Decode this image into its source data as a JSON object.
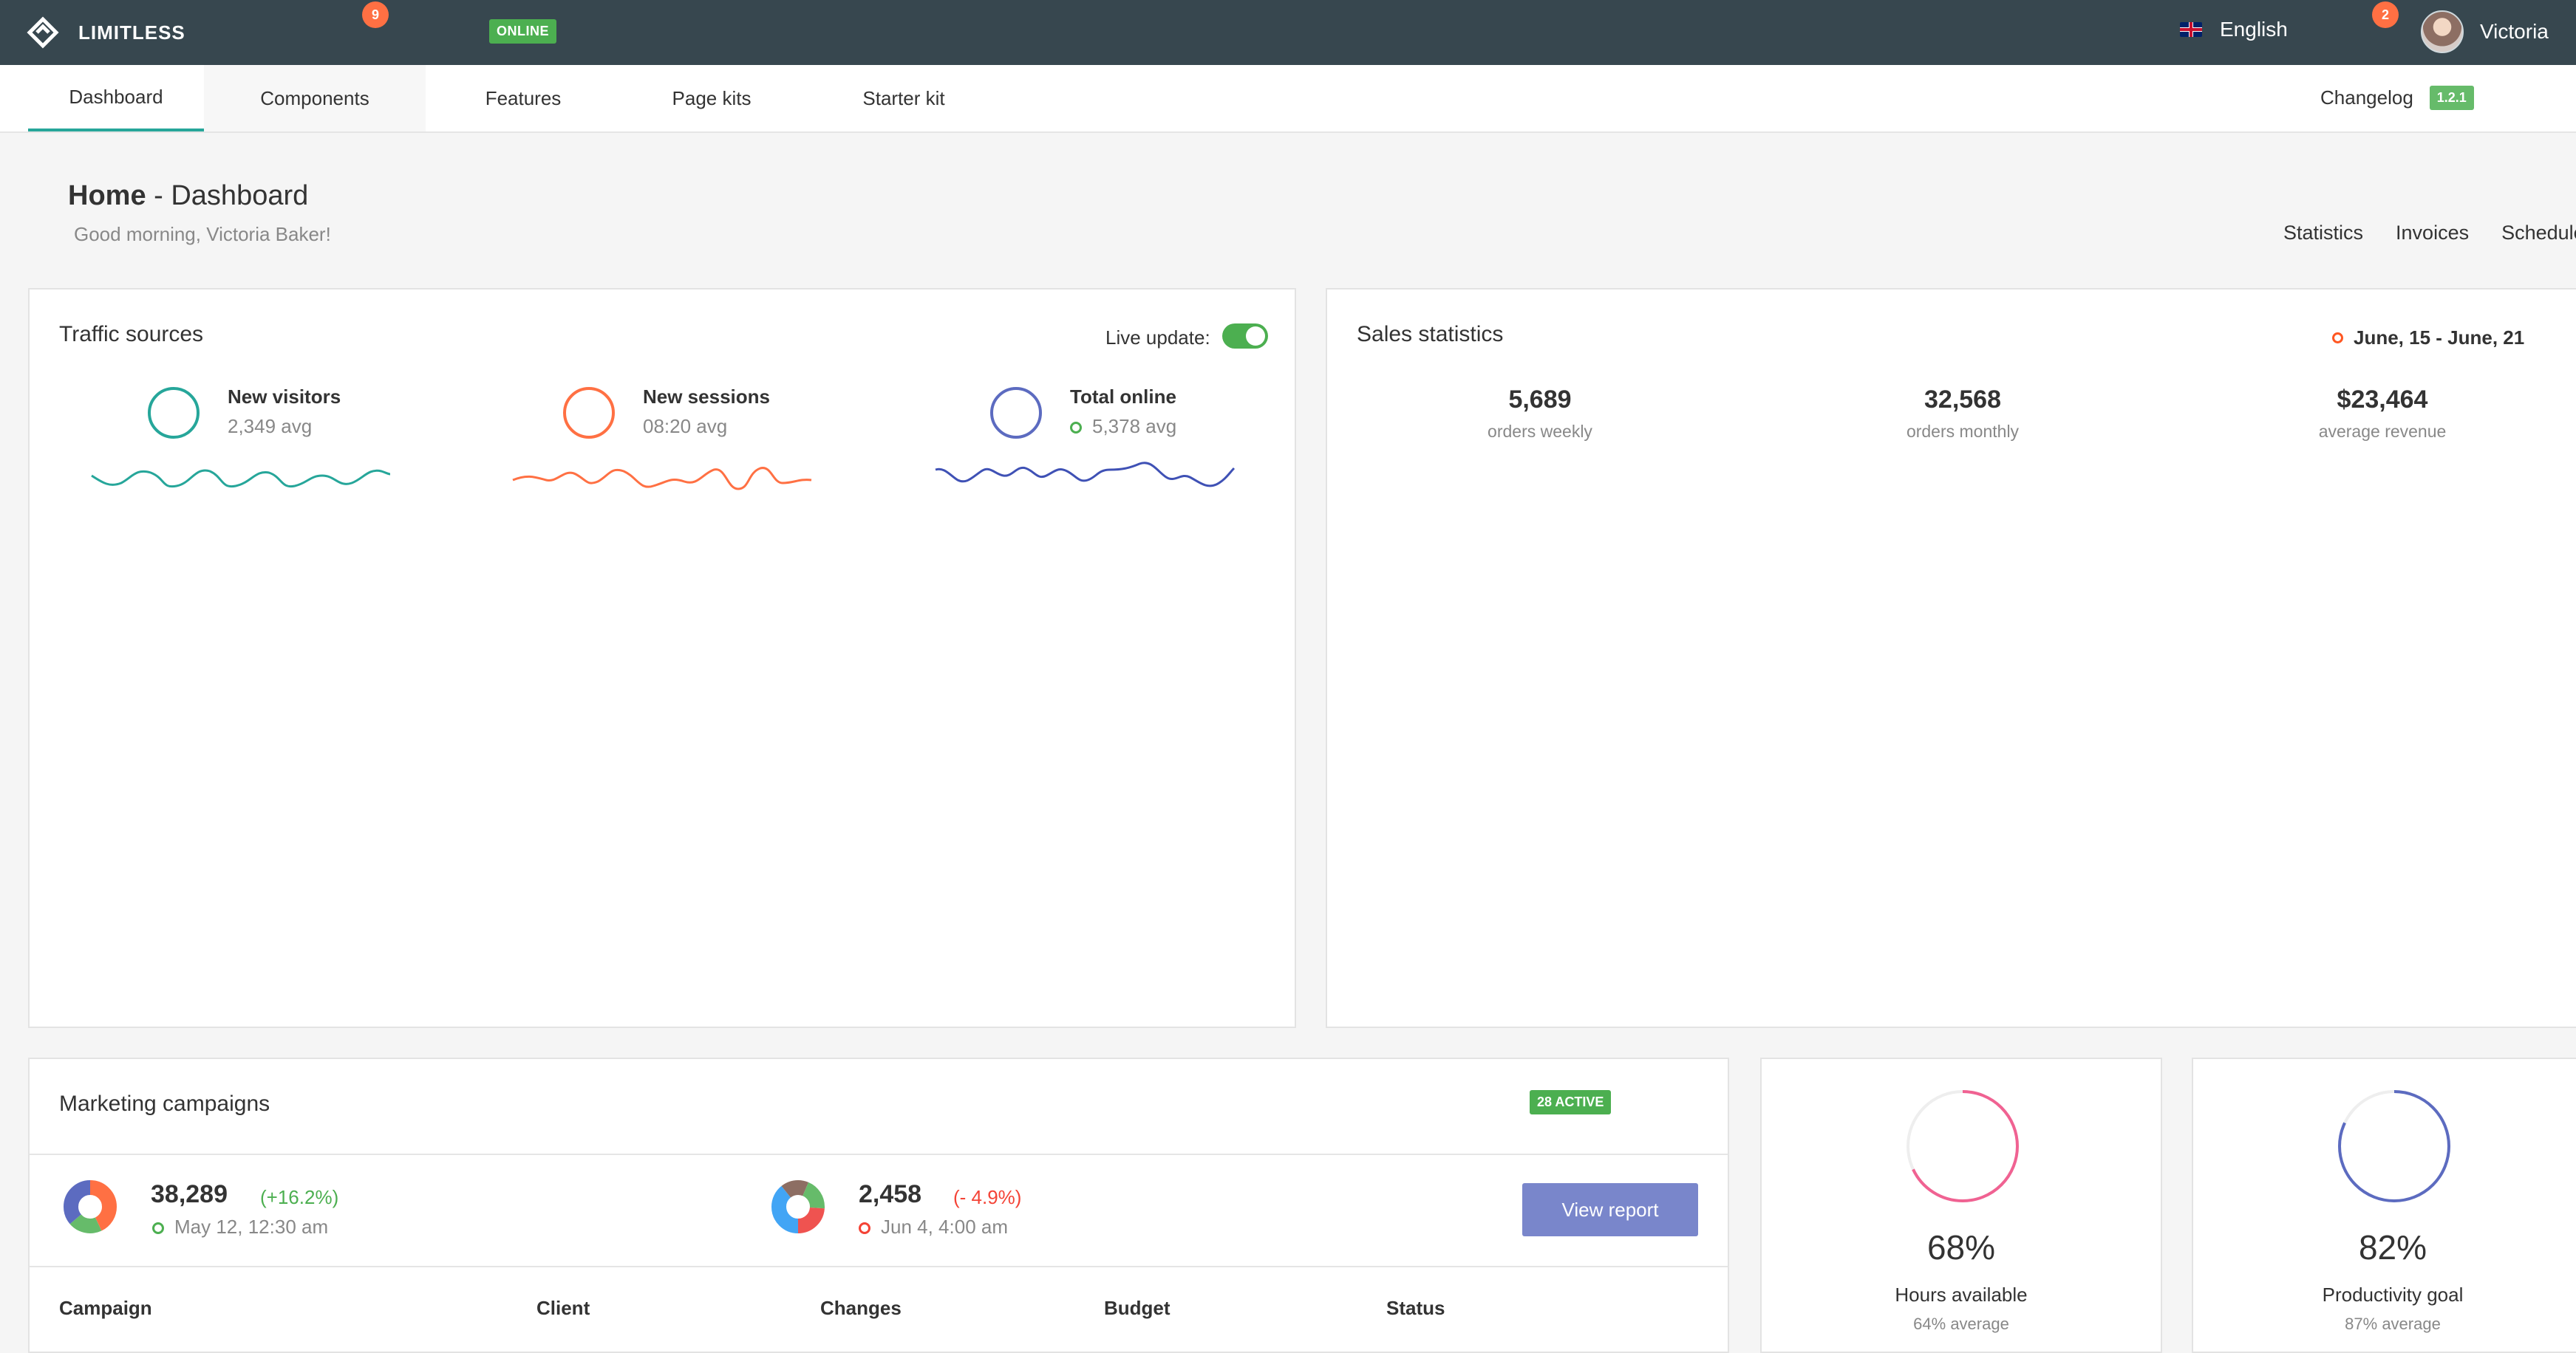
{
  "topbar": {
    "brand": "LIMITLESS",
    "badge_left": "9",
    "status_label": "ONLINE",
    "language": "English",
    "notif_count": "2",
    "user_name": "Victoria"
  },
  "subnav": {
    "tabs": [
      {
        "label": "Dashboard"
      },
      {
        "label": "Components"
      },
      {
        "label": "Features"
      },
      {
        "label": "Page kits"
      },
      {
        "label": "Starter kit"
      }
    ],
    "changelog_label": "Changelog",
    "version": "1.2.1"
  },
  "header": {
    "title_main": "Home",
    "title_sep": " - ",
    "title_sub": "Dashboard",
    "greeting": "Good morning, Victoria Baker!",
    "links": [
      "Statistics",
      "Invoices",
      "Schedule"
    ]
  },
  "traffic": {
    "title": "Traffic sources",
    "live_label": "Live update:",
    "live_enabled": true,
    "stats": [
      {
        "name": "New visitors",
        "value": "2,349 avg",
        "color": "#26a69a",
        "show_dot": false
      },
      {
        "name": "New sessions",
        "value": "08:20 avg",
        "color": "#ff7043",
        "show_dot": false
      },
      {
        "name": "Total online",
        "value": "5,378 avg",
        "color": "#5c6bc0",
        "show_dot": true,
        "dot_color": "#4caf50"
      }
    ]
  },
  "sales": {
    "title": "Sales statistics",
    "date_range": "June, 15 - June, 21",
    "date_dot_color": "#ff5722",
    "stats": [
      {
        "value": "5,689",
        "label": "orders weekly"
      },
      {
        "value": "32,568",
        "label": "orders monthly"
      },
      {
        "value": "$23,464",
        "label": "average revenue"
      }
    ]
  },
  "marketing": {
    "title": "Marketing campaigns",
    "active_badge": "28 ACTIVE",
    "summary": [
      {
        "value": "38,289",
        "change": "(+16.2%)",
        "change_color": "#4caf50",
        "date": "May 12, 12:30 am",
        "dot_color": "#4caf50"
      },
      {
        "value": "2,458",
        "change": "(- 4.9%)",
        "change_color": "#f44336",
        "date": "Jun 4, 4:00 am",
        "dot_color": "#f44336"
      }
    ],
    "view_report": "View report",
    "columns": [
      "Campaign",
      "Client",
      "Changes",
      "Budget",
      "Status"
    ]
  },
  "progress": [
    {
      "percent": "68%",
      "fraction": 0.68,
      "label": "Hours available",
      "sub": "64% average",
      "color": "#f06292"
    },
    {
      "percent": "82%",
      "fraction": 0.82,
      "label": "Productivity goal",
      "sub": "87% average",
      "color": "#5c6bc0"
    }
  ]
}
